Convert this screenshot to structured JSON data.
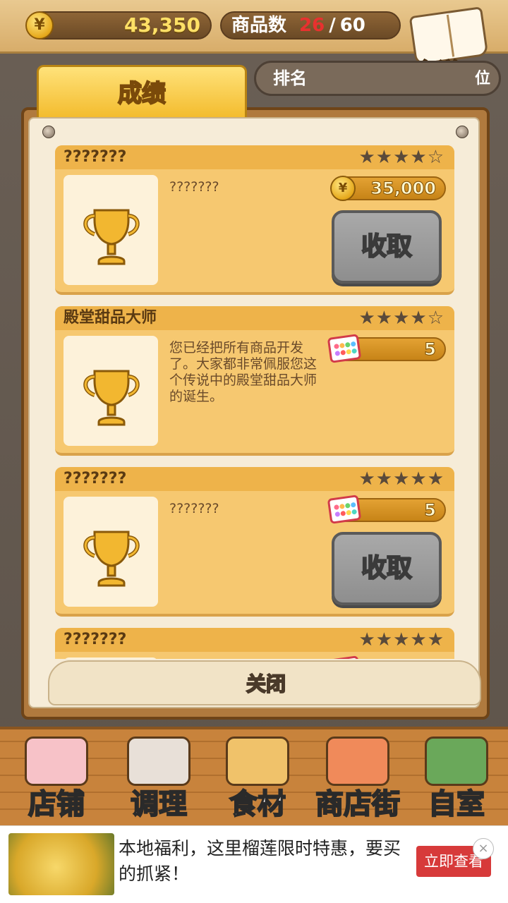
{
  "topbar": {
    "money_icon": "yen-coin-icon",
    "money": "43,350",
    "goods_label": "商品数",
    "goods_current": "26",
    "goods_slash": "/",
    "goods_max": "60",
    "recipe_label": "食谱"
  },
  "tabs": {
    "active": "成绩",
    "inactive": "排名",
    "inactive_suffix": "位"
  },
  "achievements": [
    {
      "title": "???????",
      "stars": "★★★★☆",
      "desc": "???????",
      "reward_type": "coin",
      "reward": "35,000",
      "button": "收取"
    },
    {
      "title": "殿堂甜品大师",
      "stars": "★★★★☆",
      "desc": "您已经把所有商品开发了。大家都非常佩服您这个传说中的殿堂甜品大师的诞生。",
      "reward_type": "gem",
      "reward": "5",
      "button": ""
    },
    {
      "title": "???????",
      "stars": "★★★★★",
      "desc": "???????",
      "reward_type": "gem",
      "reward": "5",
      "button": "收取"
    },
    {
      "title": "???????",
      "stars": "★★★★★",
      "desc": "",
      "reward_type": "gem",
      "reward": "",
      "button": ""
    }
  ],
  "close_label": "关闭",
  "nav": [
    {
      "label": "店铺",
      "icon": "cake-icon"
    },
    {
      "label": "调理",
      "icon": "mixing-bowl-icon"
    },
    {
      "label": "食材",
      "icon": "flour-sack-icon"
    },
    {
      "label": "商店街",
      "icon": "shop-street-icon"
    },
    {
      "label": "自室",
      "icon": "staff-only-sign-icon"
    }
  ],
  "ad": {
    "text": "本地福利，这里榴莲限时特惠，要买的抓紧！",
    "button": "立即查看",
    "close": "×"
  },
  "colors": {
    "accent": "#f3bb2c",
    "card": "#f6c870",
    "button_gray": "#9a9a9a",
    "red": "#e8312f"
  }
}
